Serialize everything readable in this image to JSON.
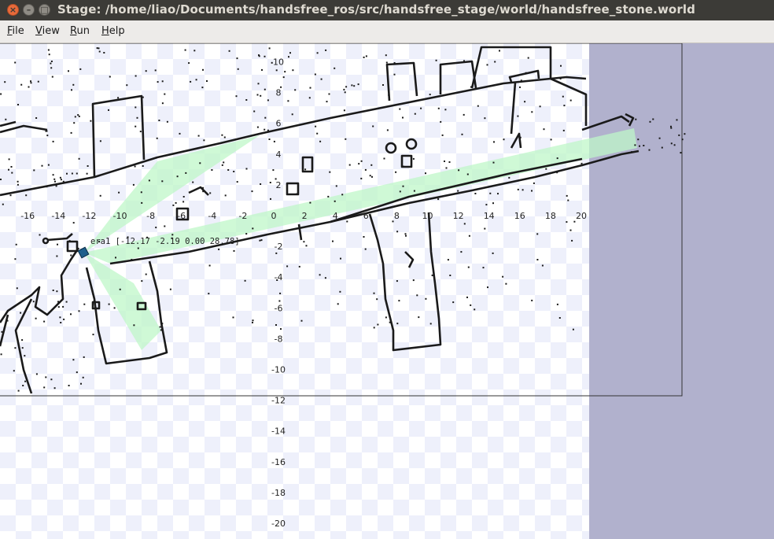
{
  "window": {
    "title": "Stage: /home/liao/Documents/handsfree_ros/src/handsfree_stage/world/handsfree_stone.world",
    "close_glyph": "×",
    "minimize_glyph": "–",
    "maximize_glyph": "□"
  },
  "menu": {
    "file": {
      "mnemonic": "F",
      "rest": "ile"
    },
    "view": {
      "mnemonic": "V",
      "rest": "iew"
    },
    "run": {
      "mnemonic": "R",
      "rest": "un"
    },
    "help": {
      "mnemonic": "H",
      "rest": "elp"
    }
  },
  "robot": {
    "label": "era1 [-12.17 -2.19 0.00 28.78]",
    "color": "#1e5f8c"
  },
  "laser": {
    "color": "#bff7c8"
  },
  "axis": {
    "x_ticks": [
      -16,
      -14,
      -12,
      -10,
      -8,
      -6,
      -4,
      -2,
      0,
      2,
      4,
      6,
      8,
      10,
      12,
      14,
      16,
      18,
      20
    ],
    "y_ticks": [
      10,
      8,
      6,
      4,
      2,
      -2,
      -4,
      -6,
      -8,
      -10,
      -12,
      -14,
      -16,
      -18,
      -20
    ]
  },
  "colors": {
    "background": "#b1b1cd",
    "titlebar": "#3c3b37",
    "menubar": "#edebe9",
    "grid_checker": "#eef0fb",
    "walls": "#1a1a1a"
  }
}
